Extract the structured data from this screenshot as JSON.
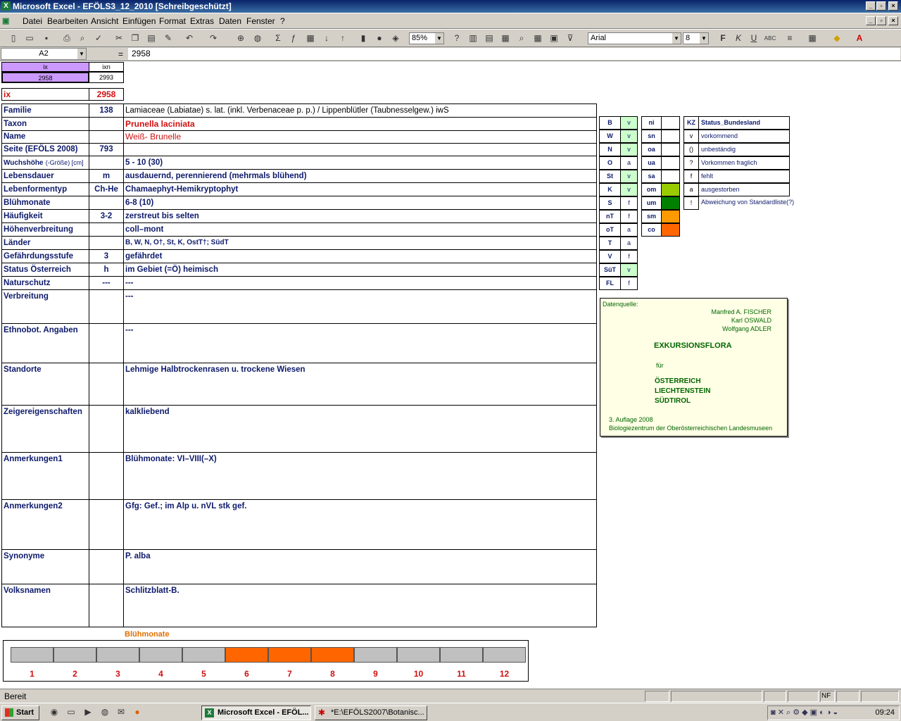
{
  "window": {
    "title": "Microsoft Excel - EFÖLS3_12_2010  [Schreibgeschützt]"
  },
  "menu": [
    "Datei",
    "Bearbeiten",
    "Ansicht",
    "Einfügen",
    "Format",
    "Extras",
    "Daten",
    "Fenster",
    "?"
  ],
  "toolbar": {
    "zoom": "85%",
    "font": "Arial",
    "size": "8"
  },
  "formula": {
    "cellref": "A2",
    "eq": "=",
    "value": "2958"
  },
  "index_table": {
    "h1": "ix",
    "h2": "ixn",
    "v1": "2958",
    "v2": "2993"
  },
  "ix": {
    "label": "ix",
    "value": "2958"
  },
  "rows": [
    {
      "label": "Familie",
      "code": "138",
      "value": "Lamiaceae (Labiatae) s. lat. (inkl. Verbenaceae p. p.)  /  Lippenblütler (Taubnesselgew.) iwS"
    },
    {
      "label": "Taxon",
      "code": "",
      "value": "Prunella laciniata"
    },
    {
      "label": "Name",
      "code": "",
      "value": "Weiß- Brunelle"
    },
    {
      "label": "Seite (EFÖLS 2008)",
      "code": "793",
      "value": ""
    },
    {
      "label": "Wuchshöhe",
      "label_small": "(-Größe) [cm]",
      "code": "",
      "value": " 5 - 10 (30)"
    },
    {
      "label": "Lebensdauer",
      "code": "m",
      "value": "ausdauernd, perennierend (mehrmals blühend)"
    },
    {
      "label": "Lebenformentyp",
      "code": "Ch-He",
      "value": "Chamaephyt-Hemikryptophyt"
    },
    {
      "label": "Blühmonate",
      "code": "",
      "value": " 6-8 (10)"
    },
    {
      "label": "Häufigkeit",
      "code": "3-2",
      "value": "zerstreut bis selten"
    },
    {
      "label": "Höhenverbreitung",
      "code": "",
      "value": "coll–mont"
    },
    {
      "label": "Länder",
      "code": "",
      "value": "B, W, N, O†, St, K, OstT†; SüdT"
    },
    {
      "label": "Gefährdungsstufe",
      "code": "3",
      "value": "gefährdet"
    },
    {
      "label": "Status Österreich",
      "code": "h",
      "value": "im Gebiet (=Ö) heimisch"
    },
    {
      "label": "Naturschutz",
      "code": "---",
      "value": " ---"
    },
    {
      "label": "Verbreitung",
      "code": "",
      "value": " ---"
    },
    {
      "label": "Ethnobot. Angaben",
      "code": "",
      "value": "---"
    },
    {
      "label": "Standorte",
      "code": "",
      "value": "Lehmige Halbtrockenrasen u. trockene Wiesen"
    },
    {
      "label": "Zeigereigenschaften",
      "code": "",
      "value": "kalkliebend"
    },
    {
      "label": "Anmerkungen1",
      "code": "",
      "value": "Blühmonate: VI–VIII(–X)"
    },
    {
      "label": "Anmerkungen2",
      "code": "",
      "value": "Gfg: Gef.; im Alp u. nVL stk gef."
    },
    {
      "label": "Synonyme",
      "code": "",
      "value": "P. alba"
    },
    {
      "label": "Volksnamen",
      "code": "",
      "value": "Schlitzblatt-B."
    }
  ],
  "states": [
    {
      "k": "B",
      "v": "v"
    },
    {
      "k": "W",
      "v": "v"
    },
    {
      "k": "N",
      "v": "v"
    },
    {
      "k": "O",
      "v": "a"
    },
    {
      "k": "St",
      "v": "v"
    },
    {
      "k": "K",
      "v": "v"
    },
    {
      "k": "S",
      "v": "f"
    },
    {
      "k": "nT",
      "v": "f"
    },
    {
      "k": "oT",
      "v": "a"
    },
    {
      "k": "T",
      "v": "a"
    },
    {
      "k": "V",
      "v": "f"
    },
    {
      "k": "SüT",
      "v": "v"
    },
    {
      "k": "FL",
      "v": "f"
    }
  ],
  "heights": [
    {
      "k": "ni",
      "color": "#ffffff"
    },
    {
      "k": "sn",
      "color": "#ffffff"
    },
    {
      "k": "oa",
      "color": "#ffffff"
    },
    {
      "k": "ua",
      "color": "#ffffff"
    },
    {
      "k": "sa",
      "color": "#ffffff"
    },
    {
      "k": "om",
      "color": "#99cc00"
    },
    {
      "k": "um",
      "color": "#008000"
    },
    {
      "k": "sm",
      "color": "#ff9900"
    },
    {
      "k": "co",
      "color": "#ff6600"
    }
  ],
  "status_legend": {
    "h1": "KZ",
    "h2": "Status_Bundesland",
    "items": [
      {
        "k": "v",
        "t": "vorkommend"
      },
      {
        "k": "()",
        "t": "unbeständig"
      },
      {
        "k": "?",
        "t": "Vorkommen fraglich"
      },
      {
        "k": "f",
        "t": "fehlt"
      },
      {
        "k": "a",
        "t": "ausgestorben"
      },
      {
        "k": "!",
        "t": "Abweichung von Standardliste(?)"
      }
    ]
  },
  "source": {
    "label": "Datenquelle:",
    "a1": "Manfred A. FISCHER",
    "a2": "Karl OSWALD",
    "a3": "Wolfgang ADLER",
    "title": "EXKURSIONSFLORA",
    "fuer": "für",
    "c1": "ÖSTERREICH",
    "c2": "LIECHTENSTEIN",
    "c3": "SÜDTIROL",
    "ed": "3. Auflage 2008",
    "pub": "Biologiezentrum der Oberösterreichischen Landesmuseen"
  },
  "bloom": {
    "title": "Blühmonate",
    "months": [
      "1",
      "2",
      "3",
      "4",
      "5",
      "6",
      "7",
      "8",
      "9",
      "10",
      "11",
      "12"
    ],
    "active": [
      6,
      7,
      8
    ],
    "active_color": "#ff6600",
    "inactive_color": "#c0c0c0"
  },
  "status": {
    "text": "Bereit",
    "nf": "NF"
  },
  "taskbar": {
    "start": "Start",
    "task1": "Microsoft Excel - EFÖL...",
    "task2": "*E:\\EFÖLS2007\\Botanisc...",
    "clock": "09:24"
  }
}
